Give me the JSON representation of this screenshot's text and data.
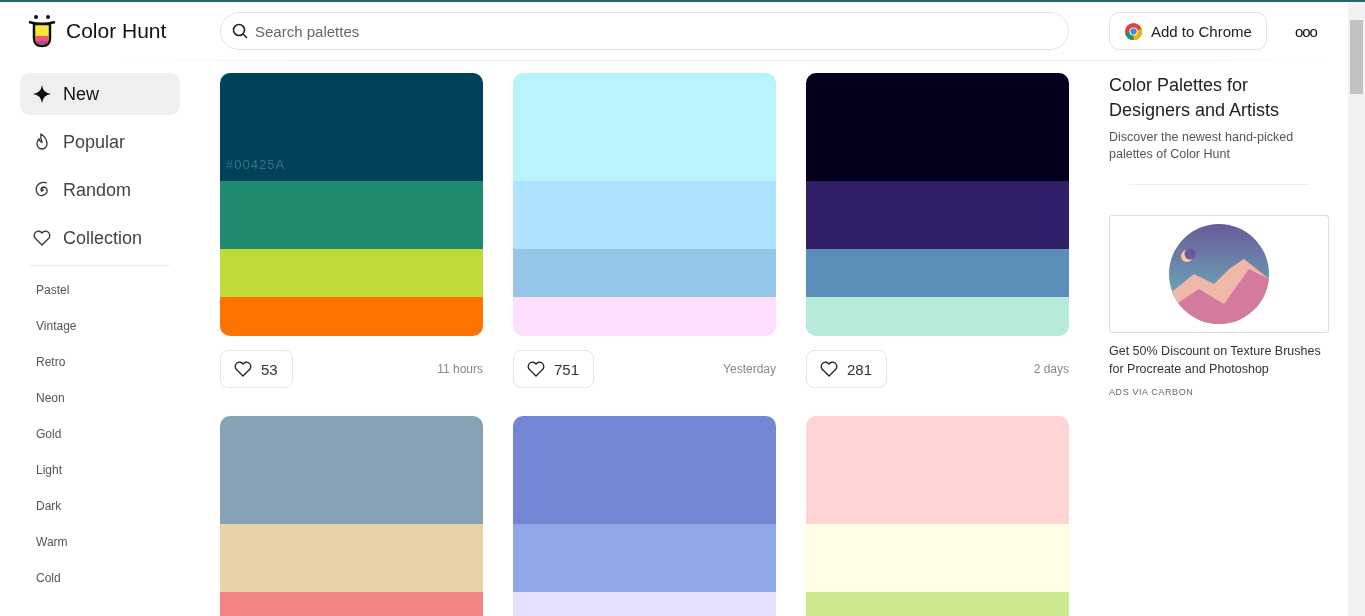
{
  "header": {
    "logo_text": "Color Hunt",
    "search": {
      "placeholder": "Search palettes"
    },
    "chrome_button": "Add to Chrome",
    "more_button": "ooo"
  },
  "sidebar": {
    "items": [
      {
        "label": "New",
        "kind": "sparkle",
        "selected": true
      },
      {
        "label": "Popular",
        "kind": "flame",
        "selected": false
      },
      {
        "label": "Random",
        "kind": "spiral",
        "selected": false
      },
      {
        "label": "Collection",
        "kind": "heart",
        "selected": false
      }
    ],
    "tags": [
      "Pastel",
      "Vintage",
      "Retro",
      "Neon",
      "Gold",
      "Light",
      "Dark",
      "Warm",
      "Cold"
    ]
  },
  "palettes": [
    {
      "swatches": [
        {
          "color": "#00425a"
        },
        {
          "color": "#1f8a70"
        },
        {
          "color": "#bfdb38"
        },
        {
          "color": "#fc7300"
        }
      ],
      "hover_label": "#00425A",
      "likes": "53",
      "time": "11 hours"
    },
    {
      "swatches": [
        {
          "color": "#b9f3fc"
        },
        {
          "color": "#aee2ff"
        },
        {
          "color": "#93c6e7"
        },
        {
          "color": "#fedeff"
        }
      ],
      "likes": "751",
      "time": "Yesterday"
    },
    {
      "swatches": [
        {
          "color": "#03001c"
        },
        {
          "color": "#301e67"
        },
        {
          "color": "#5b8fb9"
        },
        {
          "color": "#b6eada"
        }
      ],
      "likes": "281",
      "time": "2 days"
    },
    {
      "swatches": [
        {
          "color": "#87a2b5"
        },
        {
          "color": "#e8d2a6"
        },
        {
          "color": "#f48484"
        }
      ]
    },
    {
      "swatches": [
        {
          "color": "#7286d3"
        },
        {
          "color": "#8ea7e9"
        },
        {
          "color": "#e5e0ff"
        }
      ]
    },
    {
      "swatches": [
        {
          "color": "#ffd4d4"
        },
        {
          "color": "#fffde3"
        },
        {
          "color": "#cde990"
        }
      ]
    }
  ],
  "aside": {
    "title": "Color Palettes for Designers and Artists",
    "description": "Discover the newest hand-picked palettes of Color Hunt",
    "ad_text": "Get 50% Discount on Texture Brushes for Procreate and Photoshop",
    "ad_label": "ADS VIA CARBON"
  }
}
